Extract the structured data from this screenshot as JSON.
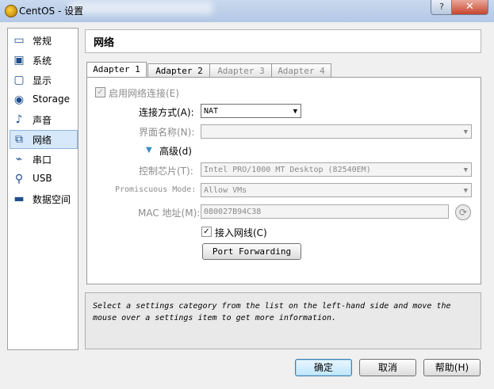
{
  "window": {
    "title": "CentOS - 设置",
    "help": "?",
    "close": "✕"
  },
  "sidebar": {
    "items": [
      {
        "label": "常规",
        "icon": "general-icon",
        "glyph": "▭"
      },
      {
        "label": "系统",
        "icon": "system-icon",
        "glyph": "▣"
      },
      {
        "label": "显示",
        "icon": "display-icon",
        "glyph": "▢"
      },
      {
        "label": "Storage",
        "icon": "storage-icon",
        "glyph": "◉"
      },
      {
        "label": "声音",
        "icon": "audio-icon",
        "glyph": "♪"
      },
      {
        "label": "网络",
        "icon": "network-icon",
        "glyph": "⧉"
      },
      {
        "label": "串口",
        "icon": "serial-port-icon",
        "glyph": "⌁"
      },
      {
        "label": "USB",
        "icon": "usb-icon",
        "glyph": "⚲"
      },
      {
        "label": "数据空间",
        "icon": "shared-folder-icon",
        "glyph": "▬"
      }
    ],
    "selected_index": 5
  },
  "header": {
    "title": "网络"
  },
  "tabs": [
    {
      "label": "Adapter 1",
      "enabled": true,
      "active": true
    },
    {
      "label": "Adapter 2",
      "enabled": true,
      "active": false
    },
    {
      "label": "Adapter 3",
      "enabled": false,
      "active": false
    },
    {
      "label": "Adapter 4",
      "enabled": false,
      "active": false
    }
  ],
  "adapter": {
    "enable_label": "启用网络连接(E)",
    "enable_checked": true,
    "attached_label": "连接方式(A):",
    "attached_value": "NAT",
    "name_label": "界面名称(N):",
    "name_value": "",
    "advanced_label": "高级(d)",
    "chip_label": "控制芯片(T):",
    "chip_value": "Intel PRO/1000 MT Desktop (82540EM)",
    "promisc_label": "Promiscuous Mode:",
    "promisc_value": "Allow VMs",
    "mac_label": "MAC 地址(M):",
    "mac_value": "080027B94C38",
    "cable_label": "接入网线(C)",
    "cable_checked": true,
    "port_forwarding_label": "Port Forwarding"
  },
  "info": {
    "text": "Select a settings category from the list on the left-hand side and move the mouse over a settings item to get more information."
  },
  "buttons": {
    "ok": "确定",
    "cancel": "取消",
    "help": "帮助(H)"
  }
}
